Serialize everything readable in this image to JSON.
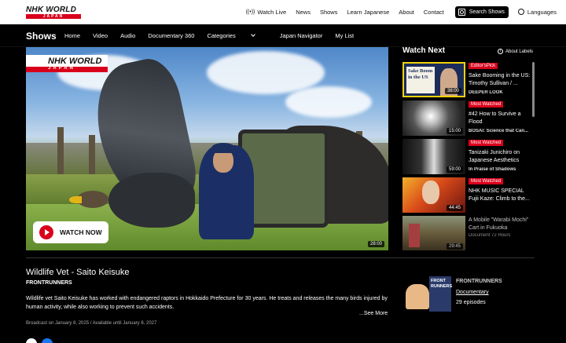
{
  "header": {
    "logo_word": "NHK WORLD",
    "logo_sub": "JAPAN",
    "nav": [
      "Watch Live",
      "News",
      "Shows",
      "Learn Japanese",
      "About",
      "Contact"
    ],
    "search_label": "Search Shows",
    "languages_label": "Languages"
  },
  "subnav": {
    "title": "Shows",
    "links": [
      "Home",
      "Video",
      "Audio",
      "Documentary 360",
      "Categories",
      "Japan Navigator",
      "My List"
    ]
  },
  "video": {
    "logo_word": "NHK WORLD",
    "logo_sub": "JAPAN",
    "watch_now": "WATCH NOW",
    "duration": "28:00"
  },
  "watch_next": {
    "heading": "Watch Next",
    "labels_link": "About Labels",
    "items": [
      {
        "badge": "Editor'sPick",
        "title": "Sake Booming in the US: Timothy Sullivan / ...",
        "sub": "DEEPER LOOK",
        "duration": "38:00",
        "thumb_text": "Sake Boom in the US"
      },
      {
        "badge": "Most Watched",
        "title": "#42 How to Survive a Flood",
        "sub": "BOSAI: Science that Can...",
        "duration": "15:00"
      },
      {
        "badge": "Most Watched",
        "title": "Tanizaki Junichiro on Japanese Aesthetics",
        "sub": "In Praise of Shadows",
        "duration": "59:00"
      },
      {
        "badge": "Most Watched",
        "title": "NHK MUSIC SPECIAL Fujii Kaze: Climb to the...",
        "sub": "",
        "duration": "44:45"
      },
      {
        "badge": "",
        "title": "A Mobile \"Warabi Mochi\" Cart in Fukuoka",
        "sub": "Document 72 Hours",
        "duration": "29:45"
      }
    ]
  },
  "episode": {
    "title": "Wildlife Vet - Saito Keisuke",
    "series": "FRONTRUNNERS",
    "description": "Wildlife vet Saito Keisuke has worked with endangered raptors in Hokkaido Prefecture for 30 years. He treats and releases the many birds injured by human activity, while also working to prevent such accidents.",
    "see_more": "...See More",
    "broadcast": "Broadcast on January 8, 2025 / Available until January 8, 2027"
  },
  "series_card": {
    "name": "FRONTRUNNERS",
    "type": "Documentary",
    "episodes": "29 episodes",
    "thumb_text": "FRONT RUNNERS"
  },
  "colors": {
    "accent": "#d9001b",
    "background": "#000000",
    "header": "#ffffff"
  }
}
